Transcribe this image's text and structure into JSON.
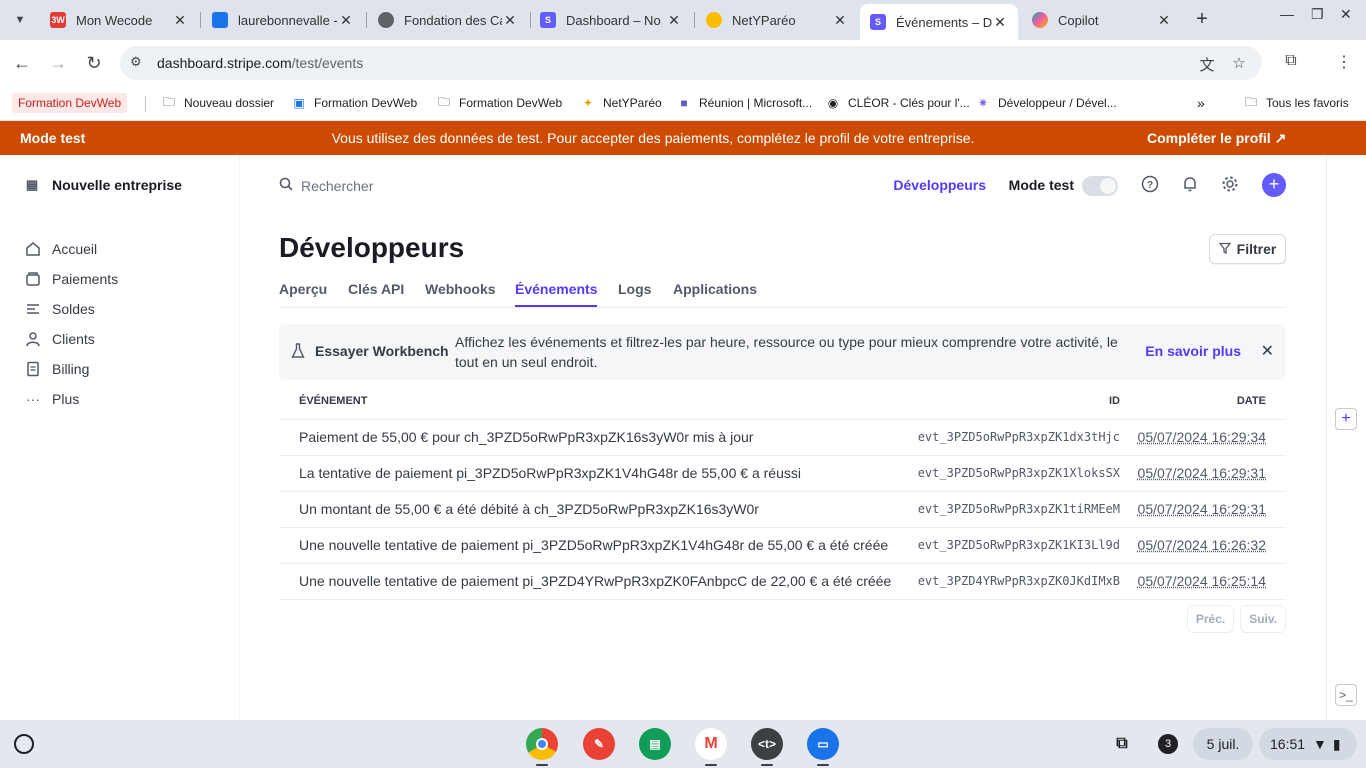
{
  "browser": {
    "tabs": [
      {
        "title": "Mon Wecode",
        "fav_text": "3W",
        "fav_color": "#e53935"
      },
      {
        "title": "laurebonnevalle - ",
        "fav_text": "",
        "fav_color": "#1a73e8"
      },
      {
        "title": "Fondation des Ca",
        "fav_text": "",
        "fav_color": "#5f6368"
      },
      {
        "title": "Dashboard – No",
        "fav_text": "S",
        "fav_color": "#635bff"
      },
      {
        "title": "NetYParéo",
        "fav_text": "",
        "fav_color": "#fbbc04"
      },
      {
        "title": "Événements – De",
        "fav_text": "S",
        "fav_color": "#635bff"
      },
      {
        "title": "Copilot",
        "fav_text": "",
        "fav_color": "#0fa6b7"
      }
    ],
    "url_host": "dashboard.stripe.com",
    "url_path": "/test/events",
    "bookmarks": [
      "Formation DevWeb",
      "Nouveau dossier",
      "Formation DevWeb",
      "Formation DevWeb",
      "NetYParéo",
      "Réunion | Microsoft...",
      "CLÉOR - Clés pour l'...",
      "Développeur / Dével...",
      "Tous les favoris"
    ]
  },
  "banner": {
    "left": "Mode test",
    "message": "Vous utilisez des données de test. Pour accepter des paiements, complétez le profil de votre entreprise.",
    "cta": "Compléter le profil ↗"
  },
  "sidebar": {
    "account": "Nouvelle entreprise",
    "items": [
      {
        "label": "Accueil",
        "icon": "home-icon"
      },
      {
        "label": "Paiements",
        "icon": "wallet-icon"
      },
      {
        "label": "Soldes",
        "icon": "balance-icon"
      },
      {
        "label": "Clients",
        "icon": "user-icon"
      },
      {
        "label": "Billing",
        "icon": "billing-icon"
      },
      {
        "label": "Plus",
        "icon": "more-icon"
      }
    ]
  },
  "header": {
    "search_placeholder": "Rechercher",
    "developers_link": "Développeurs",
    "mode_label": "Mode test"
  },
  "page": {
    "title": "Développeurs",
    "filter_label": "Filtrer",
    "tabs": [
      "Aperçu",
      "Clés API",
      "Webhooks",
      "Événements",
      "Logs",
      "Applications"
    ],
    "active_tab": "Événements"
  },
  "notice": {
    "title": "Essayer Workbench",
    "text": "Affichez les événements et filtrez-les par heure, ressource ou type pour mieux comprendre votre activité, le tout en un seul endroit.",
    "link": "En savoir plus"
  },
  "table": {
    "headers": {
      "event": "ÉVÉNEMENT",
      "id": "ID",
      "date": "DATE"
    },
    "rows": [
      {
        "event": "Paiement de 55,00 € pour ch_3PZD5oRwPpR3xpZK16s3yW0r mis à jour",
        "id": "evt_3PZD5oRwPpR3xpZK1dx3tHjc",
        "date": "05/07/2024 16:29:34"
      },
      {
        "event": "La tentative de paiement pi_3PZD5oRwPpR3xpZK1V4hG48r de 55,00 € a réussi",
        "id": "evt_3PZD5oRwPpR3xpZK1XloksSX",
        "date": "05/07/2024 16:29:31"
      },
      {
        "event": "Un montant de 55,00 € a été débité à ch_3PZD5oRwPpR3xpZK16s3yW0r",
        "id": "evt_3PZD5oRwPpR3xpZK1tiRMEeM",
        "date": "05/07/2024 16:29:31"
      },
      {
        "event": "Une nouvelle tentative de paiement pi_3PZD5oRwPpR3xpZK1V4hG48r de 55,00 € a été créée",
        "id": "evt_3PZD5oRwPpR3xpZK1KI3Ll9d",
        "date": "05/07/2024 16:26:32"
      },
      {
        "event": "Une nouvelle tentative de paiement pi_3PZD4YRwPpR3xpZK0FAnbpcC de 22,00 € a été créée",
        "id": "evt_3PZD4YRwPpR3xpZK0JKdIMxB",
        "date": "05/07/2024 16:25:14"
      }
    ],
    "prev": "Préc.",
    "next": "Suiv."
  },
  "shelf": {
    "notification_count": "3",
    "date": "5 juil.",
    "time": "16:51"
  },
  "colors": {
    "accent": "#533afd",
    "banner": "#cc4b00"
  }
}
